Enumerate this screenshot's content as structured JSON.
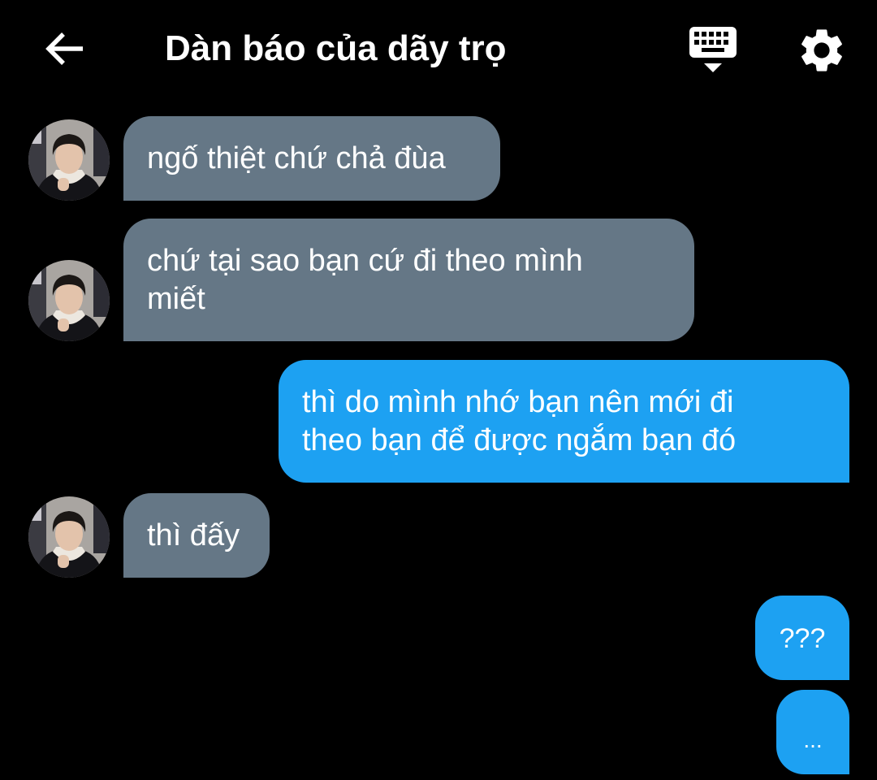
{
  "header": {
    "title": "Dàn báo của dãy trọ",
    "back_icon": "arrow-left-icon",
    "keyboard_icon": "keyboard-icon",
    "settings_icon": "gear-icon"
  },
  "colors": {
    "background": "#000000",
    "incoming_bubble": "#657786",
    "outgoing_bubble": "#1da1f2",
    "text": "#ffffff"
  },
  "messages": [
    {
      "sender": "them",
      "text": "ngố thiệt chứ chả đùa"
    },
    {
      "sender": "them",
      "text": "chứ tại sao bạn cứ đi theo mình\nmiết"
    },
    {
      "sender": "me",
      "text": "thì do mình nhớ bạn nên mới đi\ntheo bạn để được ngắm bạn đó"
    },
    {
      "sender": "them",
      "text": "thì đấy"
    },
    {
      "sender": "me",
      "text": "???"
    },
    {
      "sender": "me",
      "text": "..."
    }
  ]
}
